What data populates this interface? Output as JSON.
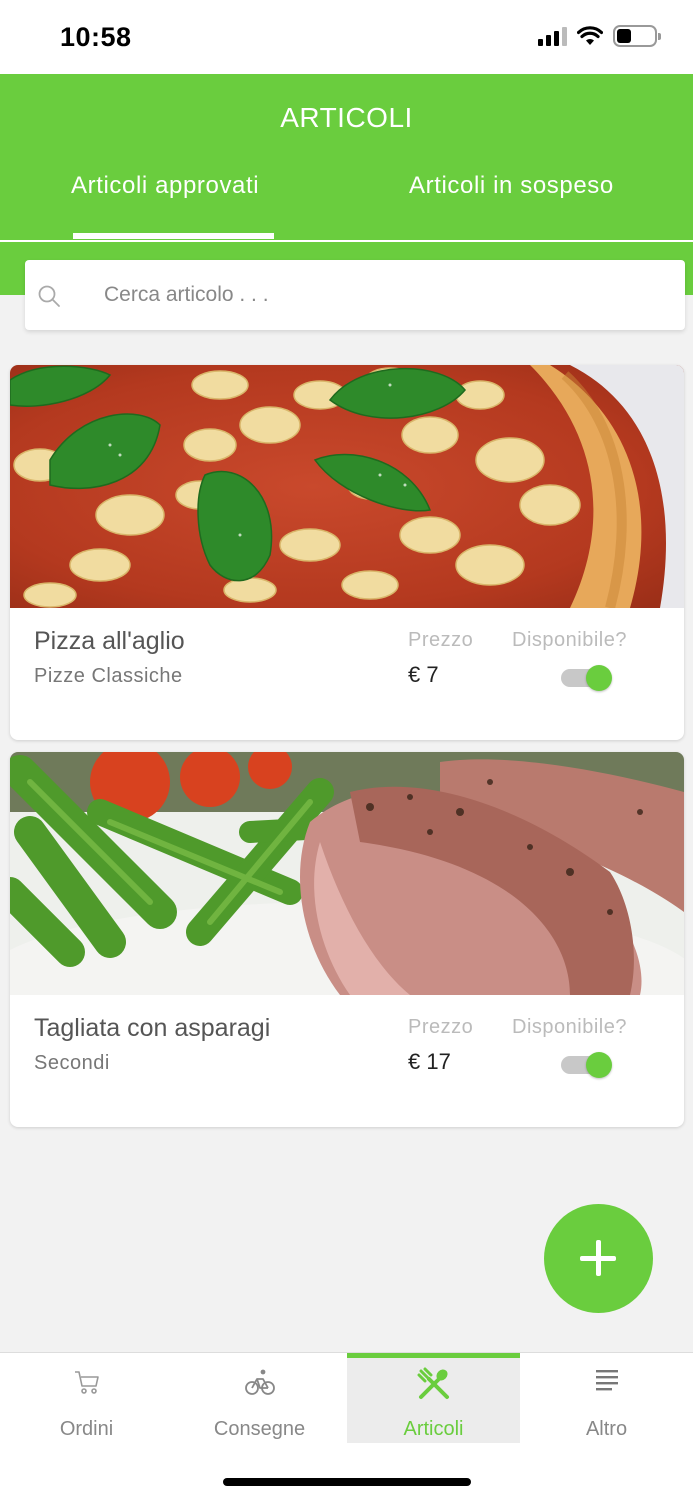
{
  "status_bar": {
    "time": "10:58"
  },
  "header": {
    "title": "ARTICOLI",
    "tabs": [
      {
        "label": "Articoli approvati",
        "active": true
      },
      {
        "label": "Articoli in sospeso",
        "active": false
      }
    ]
  },
  "search": {
    "placeholder": "Cerca articolo . . .",
    "value": ""
  },
  "items": [
    {
      "name": "Pizza all'aglio",
      "category": "Pizze Classiche",
      "price_label": "Prezzo",
      "price": "€ 7",
      "available_label": "Disponibile?",
      "available": true
    },
    {
      "name": "Tagliata con asparagi",
      "category": "Secondi",
      "price_label": "Prezzo",
      "price": "€ 17",
      "available_label": "Disponibile?",
      "available": true
    }
  ],
  "fab": {
    "icon": "plus-icon"
  },
  "bottom_nav": {
    "items": [
      {
        "label": "Ordini",
        "icon": "cart-icon",
        "active": false
      },
      {
        "label": "Consegne",
        "icon": "bicycle-icon",
        "active": false
      },
      {
        "label": "Articoli",
        "icon": "fork-knife-icon",
        "active": true
      },
      {
        "label": "Altro",
        "icon": "menu-lines-icon",
        "active": false
      }
    ]
  },
  "colors": {
    "accent": "#6acd3e",
    "background": "#f2f2f2",
    "card": "#ffffff"
  }
}
